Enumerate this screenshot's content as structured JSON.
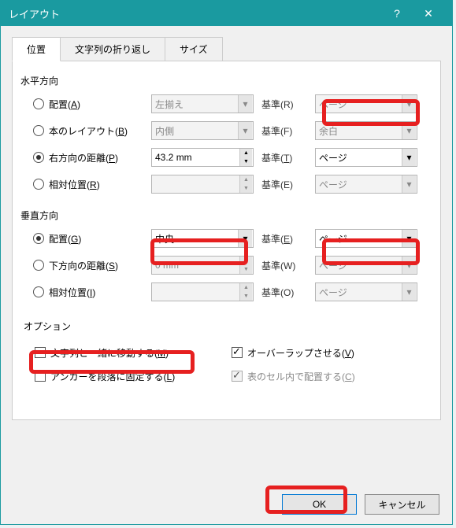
{
  "title": "レイアウト",
  "tabs": {
    "position": "位置",
    "wrap": "文字列の折り返し",
    "size": "サイズ"
  },
  "groups": {
    "horizontal": "水平方向",
    "vertical": "垂直方向",
    "options": "オプション"
  },
  "hrows": {
    "align": {
      "label_text": "配置",
      "label_key": "A",
      "value": "左揃え",
      "ref_label": "基準(R)",
      "ref_value": "ページ"
    },
    "book": {
      "label_text": "本のレイアウト",
      "label_key": "B",
      "value": "内側",
      "ref_label": "基準(F)",
      "ref_value": "余白"
    },
    "abs": {
      "label_text": "右方向の距離",
      "label_key": "P",
      "value": "43.2 mm",
      "ref_label_text": "基準",
      "ref_label_key": "T",
      "ref_value": "ページ"
    },
    "rel": {
      "label_text": "相対位置",
      "label_key": "R",
      "value": "",
      "ref_label": "基準(E)",
      "ref_value": "ページ"
    }
  },
  "vrows": {
    "align": {
      "label_text": "配置",
      "label_key": "G",
      "value": "中央",
      "ref_label_text": "基準",
      "ref_label_key": "E",
      "ref_value": "ページ"
    },
    "abs": {
      "label_text": "下方向の距離",
      "label_key": "S",
      "value": "0 mm",
      "ref_label": "基準(W)",
      "ref_value": "ページ"
    },
    "rel": {
      "label_text": "相対位置",
      "label_key": "I",
      "value": "",
      "ref_label": "基準(O)",
      "ref_value": "ページ"
    }
  },
  "opts": {
    "moveText_text": "文字列と一緒に移動する",
    "moveText_key": "M",
    "lockAnchor_text": "アンカーを段落に固定する",
    "lockAnchor_key": "L",
    "allowOverlap_text": "オーバーラップさせる",
    "allowOverlap_key": "V",
    "layoutCell_text": "表のセル内で配置する",
    "layoutCell_key": "C"
  },
  "buttons": {
    "ok": "OK",
    "cancel": "キャンセル"
  }
}
